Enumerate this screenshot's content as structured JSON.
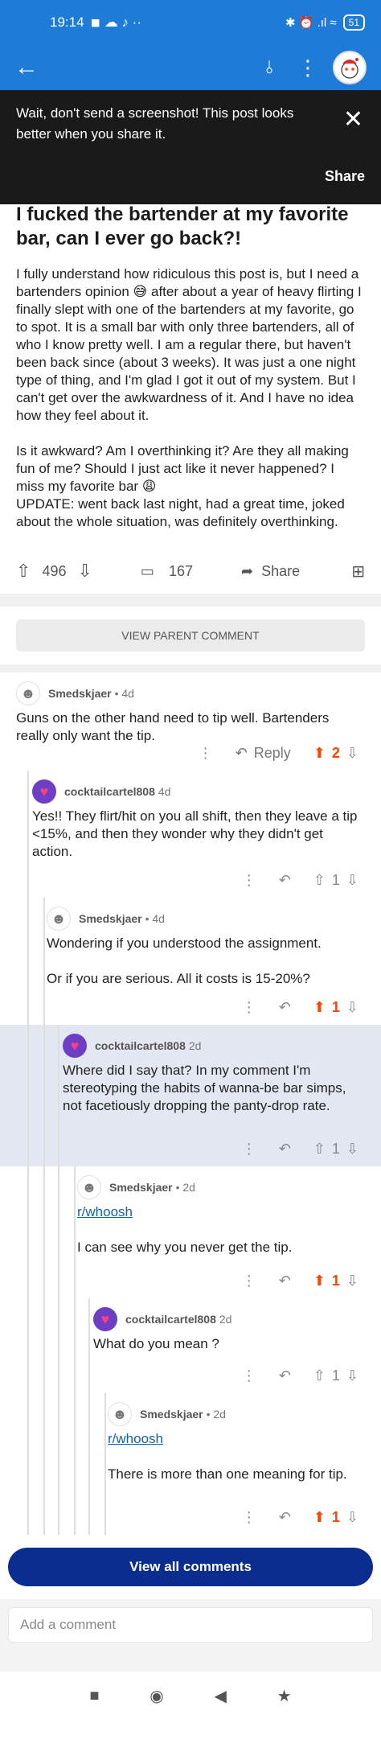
{
  "status_bar": {
    "time": "19:14",
    "left_icons": "◾ ☁ ♪ ··",
    "right_icons": "✱ ⏰ .ıl ≈",
    "battery": "51"
  },
  "app_bar": {
    "back_icon": "←",
    "sort_icon": "⫰",
    "more_icon": "⋮"
  },
  "banner": {
    "message": "Wait, don't send a screenshot! This post looks better when you share it.",
    "share": "Share",
    "close": "✕"
  },
  "post": {
    "title": "I fucked the bartender at my favorite bar, can I ever go back?!",
    "para1": "I fully understand how ridiculous this post is, but I need a bartenders opinion 😅 after about a year of heavy flirting I finally slept with one of the bartenders at my favorite, go to spot. It is a small bar with only three bartenders, all of who I know pretty well. I am a regular there, but haven't been back since (about 3 weeks). It was just a one night type of thing, and I'm glad I got it out of my system. But I can't get over the awkwardness of it. And I have no idea how they feel about it.",
    "para2": "Is it awkward? Am I overthinking it? Are they all making fun of me? Should I just act like it never happened? I miss my favorite bar 😩",
    "para3": "UPDATE: went back last night, had a great time, joked about the whole situation, was definitely overthinking.",
    "votes": "496",
    "comments": "167",
    "share": "Share"
  },
  "view_parent": "VIEW PARENT COMMENT",
  "comments": [
    {
      "author": "Smedskjaer",
      "age": "• 4d",
      "text": [
        "Guns on the other hand need to tip well. Bartenders really only want the tip."
      ],
      "reply": "Reply",
      "votes": "2",
      "upvoted": true
    },
    {
      "author": "cocktailcartel808",
      "age": "4d",
      "text": [
        "Yes!! They flirt/hit on you all shift, then they leave a tip  <15%, and then they wonder why they didn't get action."
      ],
      "votes": "1",
      "upvoted": false
    },
    {
      "author": "Smedskjaer",
      "age": "• 4d",
      "text": [
        "Wondering if you understood the assignment.",
        "Or if you are serious. All it costs is 15-20%?"
      ],
      "votes": "1",
      "upvoted": true
    },
    {
      "author": "cocktailcartel808",
      "age": "2d",
      "text": [
        "Where did I say that? In my comment I'm stereotyping the habits of wanna-be bar simps, not facetiously dropping the panty-drop rate."
      ],
      "votes": "1",
      "upvoted": false
    },
    {
      "author": "Smedskjaer",
      "age": "• 2d",
      "link": "r/whoosh",
      "text": [
        "I can see why you never get the tip."
      ],
      "votes": "1",
      "upvoted": true
    },
    {
      "author": "cocktailcartel808",
      "age": "2d",
      "text": [
        "What do you mean ?"
      ],
      "votes": "1",
      "upvoted": false
    },
    {
      "author": "Smedskjaer",
      "age": "• 2d",
      "link": "r/whoosh",
      "text": [
        "There is more than one meaning for tip."
      ],
      "votes": "1",
      "upvoted": true
    }
  ],
  "view_all": "View all comments",
  "add_comment_placeholder": "Add a comment",
  "nav": {
    "recents": "■",
    "home": "◉",
    "back": "◀",
    "accessibility": "★"
  },
  "colors": {
    "brand_blue": "#1e7bd8",
    "upvote": "#ff4500",
    "view_all": "#0a2d8f",
    "link": "#1264a3"
  }
}
